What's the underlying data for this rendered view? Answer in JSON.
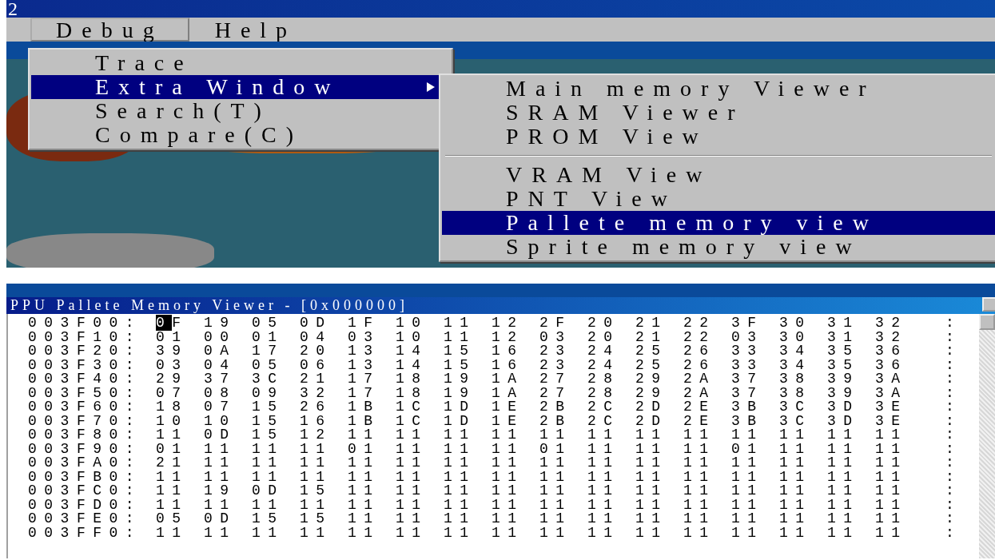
{
  "window": {
    "title": "2"
  },
  "menubar": [
    {
      "label": "Debug",
      "selected": true
    },
    {
      "label": "Help",
      "selected": false
    }
  ],
  "debug_menu": [
    {
      "label": "Trace",
      "selected": false,
      "submenu": false
    },
    {
      "label": "Extra Window",
      "selected": true,
      "submenu": true
    },
    {
      "label": "Search(T)",
      "selected": false,
      "submenu": false
    },
    {
      "label": "Compare(C)",
      "selected": false,
      "submenu": false
    }
  ],
  "extra_window_menu": [
    {
      "kind": "item",
      "label": "Main memory Viewer",
      "selected": false
    },
    {
      "kind": "item",
      "label": "SRAM Viewer",
      "selected": false
    },
    {
      "kind": "item",
      "label": "PROM View",
      "selected": false
    },
    {
      "kind": "separator"
    },
    {
      "kind": "item",
      "label": "VRAM View",
      "selected": false
    },
    {
      "kind": "item",
      "label": "PNT View",
      "selected": false
    },
    {
      "kind": "item",
      "label": "Pallete memory view",
      "selected": true
    },
    {
      "kind": "item",
      "label": "Sprite memory view",
      "selected": false
    }
  ],
  "viewer": {
    "title": "PPU Pallete Memory Viewer - [0x000000]",
    "rows": [
      {
        "address": "003F00:",
        "cursor": true,
        "end": ":",
        "bytes": [
          "0F",
          "19",
          "05",
          "0D",
          "1F",
          "10",
          "11",
          "12",
          "2F",
          "20",
          "21",
          "22",
          "3F",
          "30",
          "31",
          "32"
        ]
      },
      {
        "address": "003F10:",
        "cursor": false,
        "end": ":",
        "bytes": [
          "01",
          "00",
          "01",
          "04",
          "03",
          "10",
          "11",
          "12",
          "03",
          "20",
          "21",
          "22",
          "03",
          "30",
          "31",
          "32"
        ]
      },
      {
        "address": "003F20:",
        "cursor": false,
        "end": ":",
        "bytes": [
          "39",
          "0A",
          "17",
          "20",
          "13",
          "14",
          "15",
          "16",
          "23",
          "24",
          "25",
          "26",
          "33",
          "34",
          "35",
          "36"
        ]
      },
      {
        "address": "003F30:",
        "cursor": false,
        "end": ":",
        "bytes": [
          "03",
          "04",
          "05",
          "06",
          "13",
          "14",
          "15",
          "16",
          "23",
          "24",
          "25",
          "26",
          "33",
          "34",
          "35",
          "36"
        ]
      },
      {
        "address": "003F40:",
        "cursor": false,
        "end": ":",
        "bytes": [
          "29",
          "37",
          "3C",
          "21",
          "17",
          "18",
          "19",
          "1A",
          "27",
          "28",
          "29",
          "2A",
          "37",
          "38",
          "39",
          "3A"
        ]
      },
      {
        "address": "003F50:",
        "cursor": false,
        "end": ":",
        "bytes": [
          "07",
          "08",
          "09",
          "32",
          "17",
          "18",
          "19",
          "1A",
          "27",
          "28",
          "29",
          "2A",
          "37",
          "38",
          "39",
          "3A"
        ]
      },
      {
        "address": "003F60:",
        "cursor": false,
        "end": ":",
        "bytes": [
          "18",
          "07",
          "15",
          "26",
          "1B",
          "1C",
          "1D",
          "1E",
          "2B",
          "2C",
          "2D",
          "2E",
          "3B",
          "3C",
          "3D",
          "3E"
        ]
      },
      {
        "address": "003F70:",
        "cursor": false,
        "end": ":",
        "bytes": [
          "10",
          "10",
          "15",
          "16",
          "1B",
          "1C",
          "1D",
          "1E",
          "2B",
          "2C",
          "2D",
          "2E",
          "3B",
          "3C",
          "3D",
          "3E"
        ]
      },
      {
        "address": "003F80:",
        "cursor": false,
        "end": ":",
        "bytes": [
          "11",
          "0D",
          "15",
          "12",
          "11",
          "11",
          "11",
          "11",
          "11",
          "11",
          "11",
          "11",
          "11",
          "11",
          "11",
          "11"
        ]
      },
      {
        "address": "003F90:",
        "cursor": false,
        "end": ":",
        "bytes": [
          "01",
          "11",
          "11",
          "11",
          "01",
          "11",
          "11",
          "11",
          "01",
          "11",
          "11",
          "11",
          "01",
          "11",
          "11",
          "11"
        ]
      },
      {
        "address": "003FA0:",
        "cursor": false,
        "end": ":",
        "bytes": [
          "21",
          "11",
          "11",
          "11",
          "11",
          "11",
          "11",
          "11",
          "11",
          "11",
          "11",
          "11",
          "11",
          "11",
          "11",
          "11"
        ]
      },
      {
        "address": "003FB0:",
        "cursor": false,
        "end": ":",
        "bytes": [
          "11",
          "11",
          "11",
          "11",
          "11",
          "11",
          "11",
          "11",
          "11",
          "11",
          "11",
          "11",
          "11",
          "11",
          "11",
          "11"
        ]
      },
      {
        "address": "003FC0:",
        "cursor": false,
        "end": ":",
        "bytes": [
          "11",
          "19",
          "0D",
          "15",
          "11",
          "11",
          "11",
          "11",
          "11",
          "11",
          "11",
          "11",
          "11",
          "11",
          "11",
          "11"
        ]
      },
      {
        "address": "003FD0:",
        "cursor": false,
        "end": ":",
        "bytes": [
          "11",
          "11",
          "11",
          "11",
          "11",
          "11",
          "11",
          "11",
          "11",
          "11",
          "11",
          "11",
          "11",
          "11",
          "11",
          "11"
        ]
      },
      {
        "address": "003FE0:",
        "cursor": false,
        "end": ":",
        "bytes": [
          "05",
          "0D",
          "15",
          "15",
          "11",
          "11",
          "11",
          "11",
          "11",
          "11",
          "11",
          "11",
          "11",
          "11",
          "11",
          "11"
        ]
      },
      {
        "address": "003FF0:",
        "cursor": false,
        "end": ":",
        "bytes": [
          "11",
          "11",
          "11",
          "11",
          "11",
          "11",
          "11",
          "11",
          "11",
          "11",
          "11",
          "11",
          "11",
          "11",
          "11",
          "11"
        ]
      }
    ]
  }
}
